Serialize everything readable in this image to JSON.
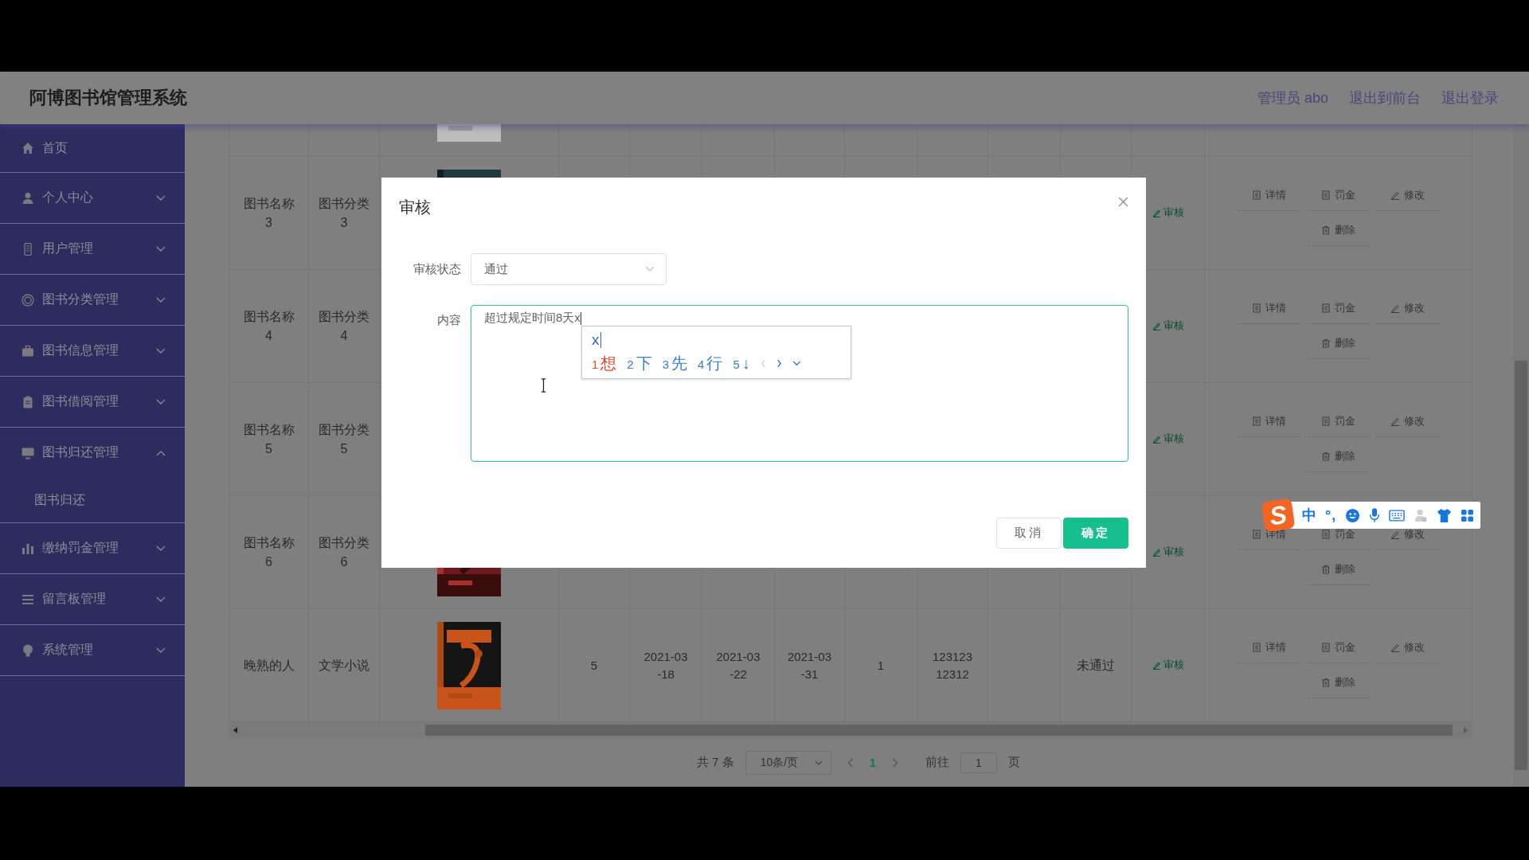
{
  "header": {
    "title": "阿博图书馆管理系统",
    "links": [
      "管理员 abo",
      "退出到前台",
      "退出登录"
    ]
  },
  "sidebar": {
    "items": [
      {
        "label": "首页",
        "kind": "link"
      },
      {
        "label": "个人中心",
        "kind": "menu",
        "expanded": false
      },
      {
        "label": "用户管理",
        "kind": "menu",
        "expanded": false
      },
      {
        "label": "图书分类管理",
        "kind": "menu",
        "expanded": false
      },
      {
        "label": "图书信息管理",
        "kind": "menu",
        "expanded": false
      },
      {
        "label": "图书借阅管理",
        "kind": "menu",
        "expanded": false
      },
      {
        "label": "图书归还管理",
        "kind": "menu",
        "expanded": true,
        "children": [
          {
            "label": "图书归还"
          }
        ]
      },
      {
        "label": "缴纳罚金管理",
        "kind": "menu",
        "expanded": false
      },
      {
        "label": "留言板管理",
        "kind": "menu",
        "expanded": false
      },
      {
        "label": "系统管理",
        "kind": "menu",
        "expanded": false
      }
    ]
  },
  "table": {
    "rows": [
      {
        "kind": "partial",
        "cover": {
          "kind": "picture"
        }
      },
      {
        "kind": "full",
        "name": "图书名称3",
        "category": "图书分类3",
        "cover": {
          "kind": "picture"
        },
        "audit": "审核",
        "actions": [
          "详情",
          "罚金",
          "修改",
          "删除"
        ]
      },
      {
        "kind": "full",
        "name": "图书名称4",
        "category": "图书分类4",
        "audit": "审核",
        "actions": [
          "详情",
          "罚金",
          "修改",
          "删除"
        ]
      },
      {
        "kind": "full",
        "name": "图书名称5",
        "category": "图书分类5",
        "audit": "审核",
        "actions": [
          "详情",
          "罚金",
          "修改",
          "删除"
        ]
      },
      {
        "kind": "full",
        "name": "图书名称6",
        "category": "图书分类6",
        "cover": {
          "kind": "picture"
        },
        "audit": "审核",
        "actions": [
          "详情",
          "罚金",
          "修改",
          "删除"
        ]
      },
      {
        "kind": "full",
        "name": "晚熟的人",
        "category": "文学小说",
        "cover": {
          "kind": "picture"
        },
        "cells": [
          "5",
          "2021-03-18",
          "2021-03-22",
          "2021-03-31",
          "1",
          "12312312312"
        ],
        "status": "未通过",
        "audit": "审核",
        "actions": [
          "详情",
          "罚金",
          "修改",
          "删除"
        ]
      }
    ]
  },
  "pagination": {
    "total": "共 7 条",
    "page_size": "10条/页",
    "pages": [
      {
        "label": "1",
        "selected": true
      }
    ],
    "goto_label": "前往",
    "goto_value": "1",
    "goto_suffix": "页"
  },
  "dialog": {
    "title": "审核",
    "fields": [
      {
        "kind": "select",
        "label": "审核状态",
        "value": "通过"
      },
      {
        "kind": "textarea",
        "label": "内容",
        "value": "超过规定时间8天x",
        "focused": true
      }
    ],
    "buttons": [
      {
        "label": "取消",
        "kind": "secondary"
      },
      {
        "label": "确定",
        "kind": "primary"
      }
    ]
  },
  "ime": {
    "composition": "x",
    "candidates": [
      {
        "index": "1",
        "text": "想",
        "selected": true
      },
      {
        "index": "2",
        "text": "下",
        "selected": false
      },
      {
        "index": "3",
        "text": "先",
        "selected": false
      },
      {
        "index": "4",
        "text": "行",
        "selected": false
      },
      {
        "index": "5",
        "text": "↓",
        "selected": false
      }
    ]
  },
  "ime_toolbar": {
    "logo": "S",
    "mode": "中",
    "punctuation": "°,"
  }
}
